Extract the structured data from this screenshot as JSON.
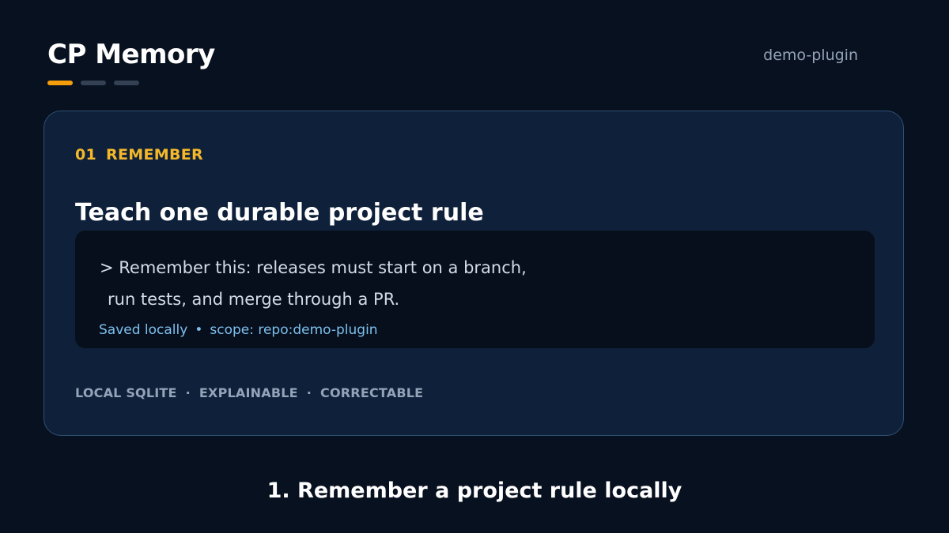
{
  "header": {
    "title": "CP Memory",
    "project": "demo-plugin",
    "steps": [
      {
        "name": "step-indicator-1",
        "active": true
      },
      {
        "name": "step-indicator-2",
        "active": false
      },
      {
        "name": "step-indicator-3",
        "active": false
      }
    ]
  },
  "card": {
    "step_number": "01",
    "step_label": "REMEMBER",
    "headline": "Teach one durable project rule",
    "prompt": {
      "line_1": "> Remember this: releases must start on a branch,",
      "line_2": "run tests, and merge through a PR."
    },
    "status": {
      "saved": "Saved locally",
      "separator": "•",
      "scope": "scope: repo:demo-plugin"
    },
    "features": [
      "LOCAL SQLITE",
      "EXPLAINABLE",
      "CORRECTABLE"
    ],
    "feature_separator": "·"
  },
  "caption": "1. Remember a project rule locally",
  "colors": {
    "background": "#081120",
    "card": "#0f213a",
    "accent": "#f59e0b",
    "step_label": "#f5b829",
    "status": "#7cc0ee"
  }
}
